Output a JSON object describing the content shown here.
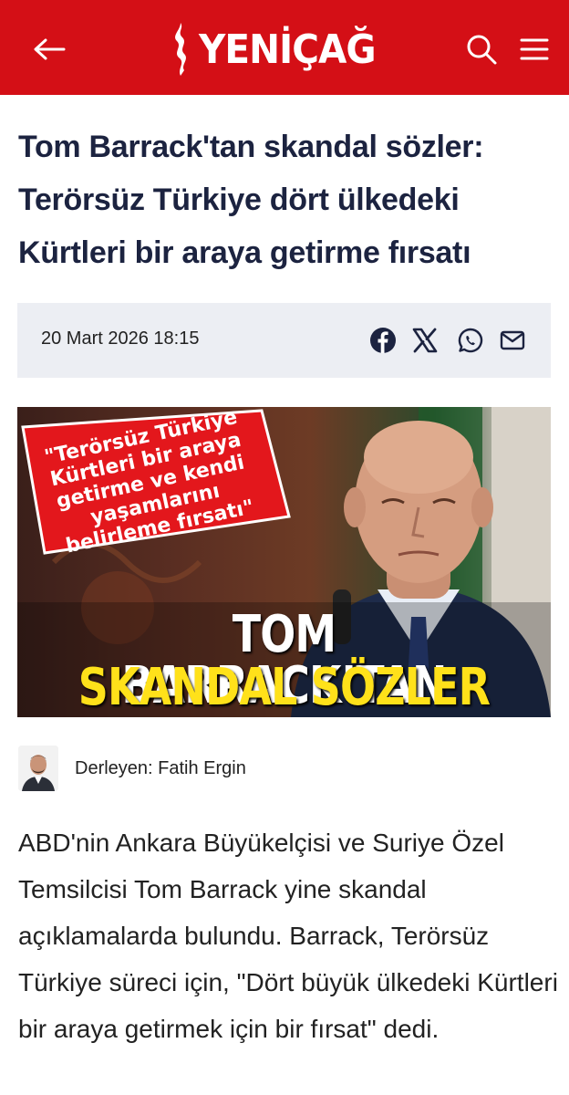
{
  "colors": {
    "brand_red": "#d40f16",
    "headline": "#1c2340",
    "meta_bg": "#eceef3",
    "accent_yellow": "#ffe11a"
  },
  "header": {
    "logo_text": "YENİÇAĞ",
    "icons": [
      "back-arrow-icon",
      "search-icon",
      "menu-icon"
    ]
  },
  "article": {
    "title": "Tom Barrack'tan skandal sözler: Terörsüz Türkiye dört ülkedeki Kürtleri bir araya getirme fırsatı",
    "date": "20 Mart 2026 18:15",
    "share_icons": [
      "facebook-icon",
      "x-icon",
      "whatsapp-icon",
      "mail-icon"
    ],
    "image": {
      "quote": "\"Terörsüz Türkiye Kürtleri bir araya getirme ve kendi yaşamlarını belirleme fırsatı\"",
      "headline_line1": "TOM BARRACK’TAN",
      "headline_line2": "SKANDAL SÖZLER"
    },
    "author_label": "Derleyen: Fatih Ergin",
    "body": "ABD'nin Ankara Büyükelçisi ve Suriye Özel Temsilcisi Tom Barrack yine skandal açıklamalarda bulundu. Barrack, Terörsüz Türkiye süreci için, \"Dört büyük ülkedeki Kürtleri bir araya getirmek için bir fırsat\" dedi."
  }
}
